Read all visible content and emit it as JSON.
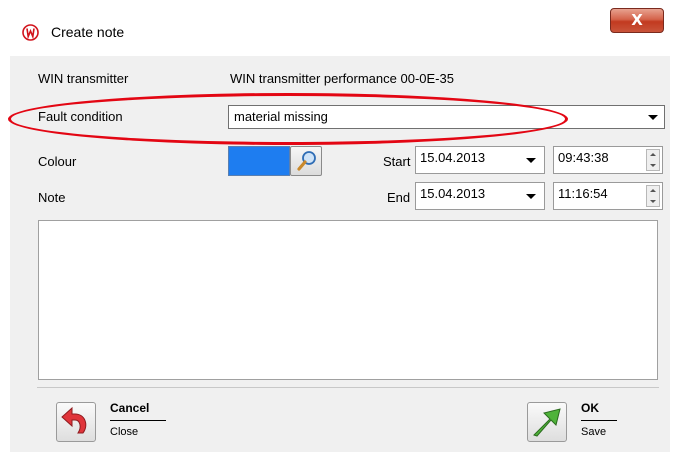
{
  "window": {
    "title": "Create note",
    "close_label": "X"
  },
  "form": {
    "transmitter": {
      "label": "WIN transmitter",
      "value": "WIN transmitter performance 00-0E-35"
    },
    "fault_condition": {
      "label": "Fault condition",
      "value": "material missing"
    },
    "colour": {
      "label": "Colour",
      "value": "#1e7df0"
    },
    "note": {
      "label": "Note",
      "value": ""
    },
    "start": {
      "label": "Start",
      "date": "15.04.2013",
      "time": "09:43:38"
    },
    "end": {
      "label": "End",
      "date": "15.04.2013",
      "time": "11:16:54"
    }
  },
  "actions": {
    "cancel": {
      "title": "Cancel",
      "subtitle": "Close"
    },
    "ok": {
      "title": "OK",
      "subtitle": "Save"
    }
  },
  "annotation_color": "#e30613"
}
